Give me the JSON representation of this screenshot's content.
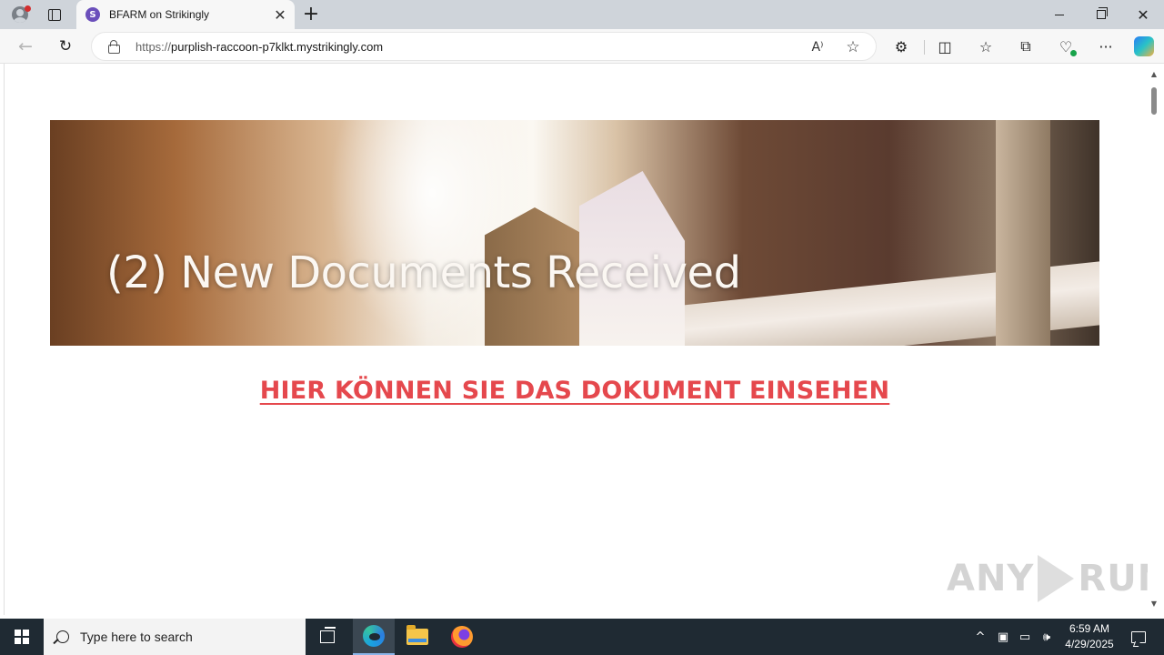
{
  "browser": {
    "tab": {
      "favicon_letter": "S",
      "title": "BFARM on Strikingly",
      "close": "✕"
    },
    "new_tab": "+",
    "window": {
      "close": "✕"
    },
    "nav": {
      "back": "←",
      "reload": "↻"
    },
    "address": {
      "protocol": "https://",
      "host": "purplish-raccoon-p7klkt.mystrikingly.com"
    },
    "toolbar": {
      "read_aloud": "A⁾",
      "favorite": "☆",
      "extensions": "⚙",
      "split": "◫",
      "favorites_bar": "☆",
      "collections": "⧉",
      "more": "···"
    }
  },
  "page": {
    "banner_text": "(2) New Documents Received",
    "document_link": "HIER KÖNNEN SIE DAS DOKUMENT EINSEHEN",
    "watermark_left": "ANY",
    "watermark_right": "RUN"
  },
  "taskbar": {
    "search_placeholder": "Type here to search",
    "tray": {
      "chevron": "^",
      "volume": "🕪"
    },
    "clock": {
      "time": "6:59 AM",
      "date": "4/29/2025"
    }
  },
  "colors": {
    "link": "#e5484d",
    "taskbar": "#1f2a33",
    "tab_strip": "#cfd4da",
    "favicon": "#6b4fbb"
  }
}
